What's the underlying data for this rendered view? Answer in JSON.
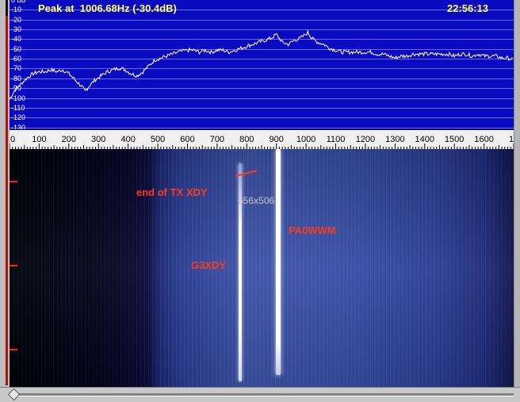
{
  "spectrum": {
    "peak_text": "Peak at  1006.68Hz (-30.4dB)",
    "clock": "22:56:13",
    "db_labels": [
      "0 dB",
      "-10",
      "-20",
      "-30",
      "-40",
      "-50",
      "-60",
      "-70",
      "-80",
      "-90",
      "-100",
      "-110",
      "-120",
      "-130"
    ],
    "colors": {
      "background": "#0a0ac0",
      "grid": "#6a6aff",
      "trace": "#ffffff",
      "text": "#ffff66"
    },
    "trace_points_hz_db": [
      [
        0,
        -98
      ],
      [
        20,
        -88
      ],
      [
        40,
        -82
      ],
      [
        60,
        -76
      ],
      [
        80,
        -72
      ],
      [
        100,
        -70
      ],
      [
        120,
        -70
      ],
      [
        140,
        -68
      ],
      [
        160,
        -70
      ],
      [
        180,
        -68
      ],
      [
        200,
        -72
      ],
      [
        220,
        -78
      ],
      [
        240,
        -84
      ],
      [
        255,
        -90
      ],
      [
        270,
        -84
      ],
      [
        290,
        -78
      ],
      [
        310,
        -74
      ],
      [
        330,
        -70
      ],
      [
        350,
        -68
      ],
      [
        370,
        -66
      ],
      [
        390,
        -68
      ],
      [
        410,
        -72
      ],
      [
        430,
        -74
      ],
      [
        450,
        -70
      ],
      [
        470,
        -64
      ],
      [
        490,
        -58
      ],
      [
        510,
        -56
      ],
      [
        530,
        -54
      ],
      [
        550,
        -52
      ],
      [
        570,
        -50
      ],
      [
        600,
        -48
      ],
      [
        620,
        -48
      ],
      [
        640,
        -50
      ],
      [
        660,
        -48
      ],
      [
        680,
        -50
      ],
      [
        700,
        -48
      ],
      [
        720,
        -48
      ],
      [
        740,
        -50
      ],
      [
        760,
        -48
      ],
      [
        780,
        -46
      ],
      [
        800,
        -44
      ],
      [
        820,
        -42
      ],
      [
        840,
        -40
      ],
      [
        860,
        -38
      ],
      [
        880,
        -36
      ],
      [
        900,
        -32
      ],
      [
        920,
        -40
      ],
      [
        940,
        -42
      ],
      [
        960,
        -38
      ],
      [
        980,
        -36
      ],
      [
        1006,
        -30
      ],
      [
        1020,
        -36
      ],
      [
        1040,
        -40
      ],
      [
        1060,
        -42
      ],
      [
        1080,
        -46
      ],
      [
        1100,
        -48
      ],
      [
        1120,
        -50
      ],
      [
        1140,
        -50
      ],
      [
        1160,
        -50
      ],
      [
        1180,
        -50
      ],
      [
        1200,
        -50
      ],
      [
        1220,
        -50
      ],
      [
        1240,
        -52
      ],
      [
        1260,
        -52
      ],
      [
        1280,
        -54
      ],
      [
        1300,
        -56
      ],
      [
        1320,
        -54
      ],
      [
        1340,
        -54
      ],
      [
        1360,
        -52
      ],
      [
        1380,
        -52
      ],
      [
        1400,
        -52
      ],
      [
        1420,
        -52
      ],
      [
        1440,
        -52
      ],
      [
        1460,
        -52
      ],
      [
        1480,
        -52
      ],
      [
        1500,
        -54
      ],
      [
        1520,
        -52
      ],
      [
        1540,
        -52
      ],
      [
        1560,
        -54
      ],
      [
        1580,
        -52
      ],
      [
        1600,
        -54
      ],
      [
        1620,
        -54
      ],
      [
        1640,
        -54
      ],
      [
        1660,
        -56
      ],
      [
        1680,
        -56
      ],
      [
        1700,
        -58
      ]
    ]
  },
  "ruler": {
    "labels": [
      "0",
      "100",
      "200",
      "300",
      "400",
      "500",
      "600",
      "700",
      "800",
      "900",
      "1000",
      "1100",
      "1200",
      "1300",
      "1400",
      "1500",
      "1600",
      "1"
    ],
    "max_hz": 1700
  },
  "waterfall": {
    "annotations": {
      "end_of_tx": "end of TX XDY",
      "pa0wwm": "PA0WWM",
      "g3xdy": "G3XDY"
    },
    "size_text": "656x506",
    "traces_hz": [
      765,
      895
    ]
  }
}
